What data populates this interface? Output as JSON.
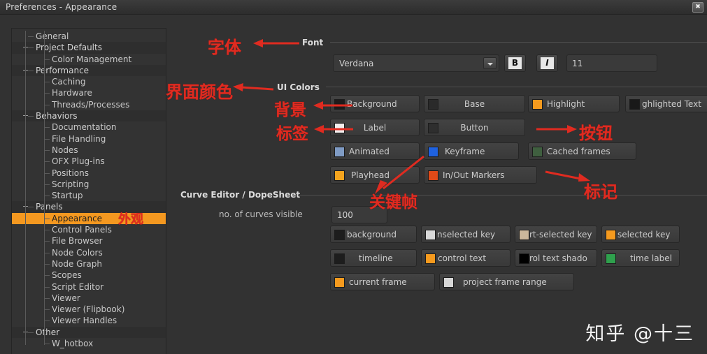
{
  "window": {
    "title": "Preferences - Appearance",
    "close_label": "✖"
  },
  "colors": {
    "window_bg": "#323232",
    "panel_bg": "#333333",
    "selection": "#f49820",
    "annotation_red": "#e02b20",
    "text": "#cccccc"
  },
  "sidebar": {
    "items": [
      {
        "label": "General",
        "depth": 1,
        "type": "leaf"
      },
      {
        "label": "Project Defaults",
        "depth": 1,
        "type": "group"
      },
      {
        "label": "Color Management",
        "depth": 2,
        "type": "leaf"
      },
      {
        "label": "Performance",
        "depth": 1,
        "type": "group"
      },
      {
        "label": "Caching",
        "depth": 2,
        "type": "leaf"
      },
      {
        "label": "Hardware",
        "depth": 2,
        "type": "leaf"
      },
      {
        "label": "Threads/Processes",
        "depth": 2,
        "type": "leaf"
      },
      {
        "label": "Behaviors",
        "depth": 1,
        "type": "group"
      },
      {
        "label": "Documentation",
        "depth": 2,
        "type": "leaf"
      },
      {
        "label": "File Handling",
        "depth": 2,
        "type": "leaf"
      },
      {
        "label": "Nodes",
        "depth": 2,
        "type": "leaf"
      },
      {
        "label": "OFX Plug-ins",
        "depth": 2,
        "type": "leaf"
      },
      {
        "label": "Positions",
        "depth": 2,
        "type": "leaf"
      },
      {
        "label": "Scripting",
        "depth": 2,
        "type": "leaf"
      },
      {
        "label": "Startup",
        "depth": 2,
        "type": "leaf"
      },
      {
        "label": "Panels",
        "depth": 1,
        "type": "group"
      },
      {
        "label": "Appearance",
        "depth": 2,
        "type": "leaf",
        "selected": true
      },
      {
        "label": "Control Panels",
        "depth": 2,
        "type": "leaf"
      },
      {
        "label": "File Browser",
        "depth": 2,
        "type": "leaf"
      },
      {
        "label": "Node Colors",
        "depth": 2,
        "type": "leaf"
      },
      {
        "label": "Node Graph",
        "depth": 2,
        "type": "leaf"
      },
      {
        "label": "Scopes",
        "depth": 2,
        "type": "leaf"
      },
      {
        "label": "Script Editor",
        "depth": 2,
        "type": "leaf"
      },
      {
        "label": "Viewer",
        "depth": 2,
        "type": "leaf"
      },
      {
        "label": "Viewer (Flipbook)",
        "depth": 2,
        "type": "leaf"
      },
      {
        "label": "Viewer Handles",
        "depth": 2,
        "type": "leaf"
      },
      {
        "label": "Other",
        "depth": 1,
        "type": "group"
      },
      {
        "label": "W_hotbox",
        "depth": 2,
        "type": "leaf"
      }
    ]
  },
  "font_section": {
    "header": "Font",
    "family_value": "Verdana",
    "bold_label": "B",
    "italic_label": "I",
    "size_value": "11"
  },
  "ui_colors_section": {
    "header": "UI Colors",
    "swatches": [
      {
        "label": "Background",
        "color": "#1f1b1b"
      },
      {
        "label": "Base",
        "color": "#2a2a2a"
      },
      {
        "label": "Highlight",
        "color": "#f59a1e"
      },
      {
        "label": "ghlighted Text",
        "color": "#191919",
        "full_label": "Highlighted Text",
        "truncated": true
      },
      {
        "label": "Label",
        "color": "#f2eeee"
      },
      {
        "label": "Button",
        "color": "#2e2e2e"
      },
      {
        "label": "Animated",
        "color": "#7f9bc4"
      },
      {
        "label": "Keyframe",
        "color": "#1f62e0"
      },
      {
        "label": "Cached frames",
        "color": "#3f5f3f"
      },
      {
        "label": "Playhead",
        "color": "#f4a41e"
      },
      {
        "label": "In/Out Markers",
        "color": "#df4a18"
      }
    ]
  },
  "curve_editor_section": {
    "header": "Curve Editor / DopeSheet",
    "curves_visible_label": "no. of curves visible",
    "curves_visible_value": "100",
    "swatches": [
      {
        "label": "background",
        "color": "#1d1d1d"
      },
      {
        "label": "nselected key",
        "color": "#d8d8d8",
        "full_label": "unselected key",
        "truncated": true
      },
      {
        "label": "rt-selected key",
        "color": "#cbb79b",
        "full_label": "part-selected key",
        "truncated": true
      },
      {
        "label": "selected key",
        "color": "#f59a1e"
      },
      {
        "label": "timeline",
        "color": "#1d1d1d"
      },
      {
        "label": "control text",
        "color": "#f59a1e"
      },
      {
        "label": "rol text shado",
        "color": "#000000",
        "full_label": "control text shadow",
        "truncated": true
      },
      {
        "label": "time label",
        "color": "#2fa04d"
      },
      {
        "label": "current frame",
        "color": "#f59a1e"
      },
      {
        "label": "project frame range",
        "color": "#d8d8d8"
      }
    ]
  },
  "annotations": [
    {
      "text": "字体",
      "meaning": "Font"
    },
    {
      "text": "界面颜色",
      "meaning": "UI Colors"
    },
    {
      "text": "背景",
      "meaning": "Background"
    },
    {
      "text": "标签",
      "meaning": "Label"
    },
    {
      "text": "按钮",
      "meaning": "Button"
    },
    {
      "text": "关键帧",
      "meaning": "Keyframe"
    },
    {
      "text": "标记",
      "meaning": "Markers"
    },
    {
      "text": "外观",
      "meaning": "Appearance"
    }
  ],
  "watermark": "知乎 @十三"
}
